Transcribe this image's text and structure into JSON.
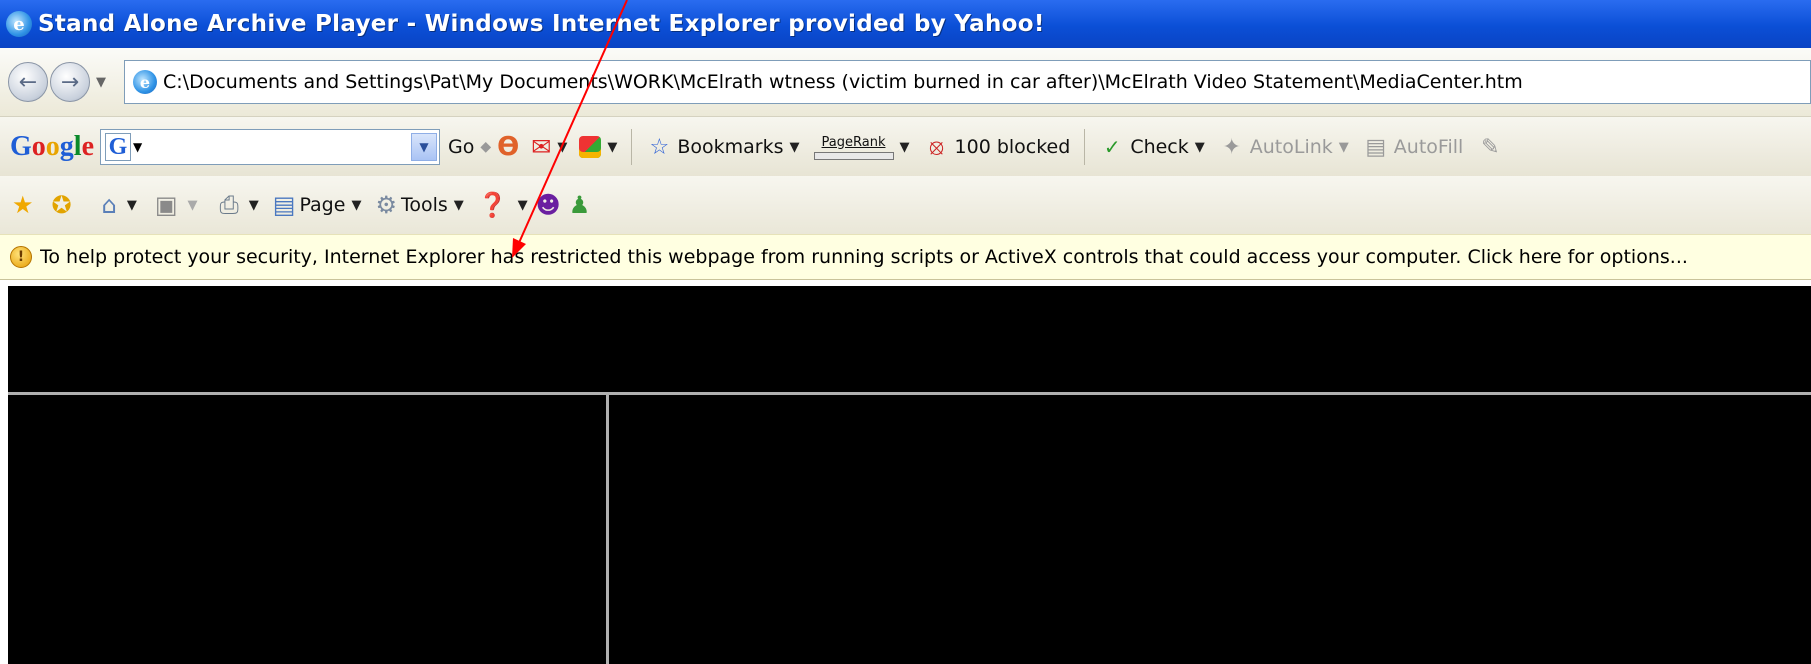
{
  "window": {
    "title": "Stand Alone Archive Player - Windows Internet Explorer provided by Yahoo!"
  },
  "address_bar": {
    "url": "C:\\Documents and Settings\\Pat\\My Documents\\WORK\\McElrath wtness (victim burned in car after)\\McElrath Video Statement\\MediaCenter.htm"
  },
  "google_toolbar": {
    "logo": [
      "G",
      "o",
      "o",
      "g",
      "l",
      "e"
    ],
    "badge": "G",
    "go_label": "Go",
    "bookmarks_label": "Bookmarks",
    "pagerank_label": "PageRank",
    "blocked_label": "100 blocked",
    "check_label": "Check",
    "autolink_label": "AutoLink",
    "autofill_label": "AutoFill"
  },
  "command_bar": {
    "page_label": "Page",
    "tools_label": "Tools"
  },
  "info_bar": {
    "message": "To help protect your security, Internet Explorer has restricted this webpage from running scripts or ActiveX controls that could access your computer. Click here for options..."
  },
  "colors": {
    "titlebar": "#0b4fd6",
    "infobar": "#ffffe1",
    "annotation_arrow": "#ff0000",
    "player_background": "#000000"
  }
}
